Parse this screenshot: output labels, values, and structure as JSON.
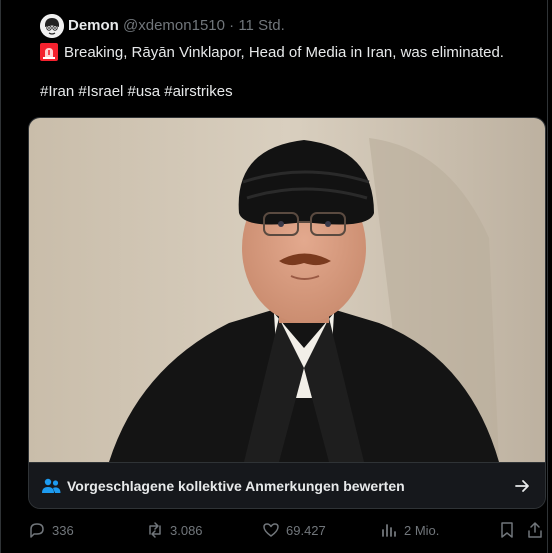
{
  "tweet": {
    "display_name": "Demon",
    "handle": "@xdemon1510",
    "separator": "·",
    "time": "11 Std.",
    "emoji": "siren-emoji",
    "text": "Breaking, Rāyān Vinklapor, Head of Media in Iran, was eliminated.",
    "hashtags": "#Iran #Israel #usa #airstrikes"
  },
  "community_notes": {
    "label": "Vorgeschlagene kollektive Anmerkungen bewerten",
    "icon": "people-icon",
    "arrow_icon": "arrow-right-icon"
  },
  "actions": {
    "replies": "336",
    "reposts": "3.086",
    "likes": "69.427",
    "views": "2 Mio."
  },
  "colors": {
    "background": "#000000",
    "text": "#e7e9ea",
    "muted": "#71767b",
    "accent": "#1d9bf0"
  }
}
